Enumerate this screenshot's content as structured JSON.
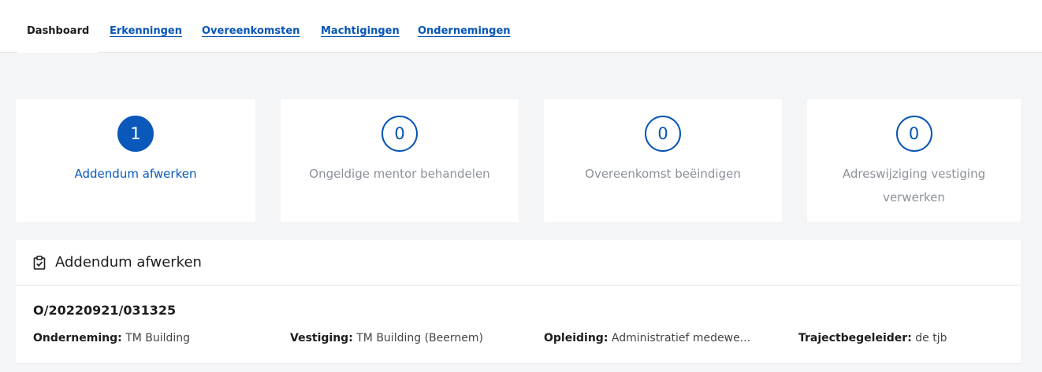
{
  "nav": {
    "tabs": [
      {
        "label": "Dashboard",
        "active": true
      },
      {
        "label": "Erkenningen",
        "active": false
      },
      {
        "label": "Overeenkomsten",
        "active": false
      },
      {
        "label": "Machtigingen",
        "active": false
      },
      {
        "label": "Ondernemingen",
        "active": false
      }
    ]
  },
  "cards": [
    {
      "count": "1",
      "label": "Addendum afwerken",
      "active": true
    },
    {
      "count": "0",
      "label": "Ongeldige mentor behandelen",
      "active": false
    },
    {
      "count": "0",
      "label": "Overeenkomst beëindigen",
      "active": false
    },
    {
      "count": "0",
      "label": "Adreswijziging vestiging verwerken",
      "active": false
    }
  ],
  "panel": {
    "icon": "clipboard-check-icon",
    "title": "Addendum afwerken",
    "item": {
      "id": "O/20220921/031325",
      "fields": [
        {
          "key": "Onderneming:",
          "value": "TM Building"
        },
        {
          "key": "Vestiging:",
          "value": "TM Building (Beernem)"
        },
        {
          "key": "Opleiding:",
          "value": "Administratief medewe..."
        },
        {
          "key": "Trajectbegeleider:",
          "value": "de tjb"
        }
      ]
    }
  },
  "colors": {
    "accent": "#0a58ba",
    "link": "#0655b5",
    "muted": "#8c919a",
    "background": "#f4f5f7"
  }
}
